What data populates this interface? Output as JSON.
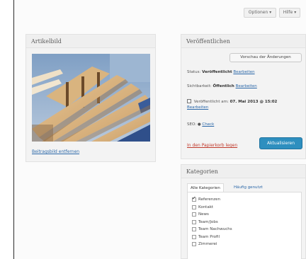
{
  "toolbar": {
    "options_label": "Optionen ▾",
    "help_label": "Hilfe ▾"
  },
  "featured": {
    "title": "Artikelbild",
    "remove_link": "Beitragsbild entfernen"
  },
  "publish": {
    "title": "Veröffentlichen",
    "preview_label": "Vorschau der Änderungen",
    "status_label": "Status:",
    "status_value": "Veröffentlicht",
    "status_edit": "Bearbeiten",
    "visibility_label": "Sichtbarkeit:",
    "visibility_value": "Öffentlich",
    "visibility_edit": "Bearbeiten",
    "published_label": "Veröffentlicht am:",
    "published_value": "07. Mai 2013 @ 15:02",
    "published_edit": "Bearbeiten",
    "seo_label": "SEO:",
    "seo_value": "Check",
    "trash_link": "In den Papierkorb legen",
    "update_label": "Aktualisieren"
  },
  "categories": {
    "title": "Kategorien",
    "tab_all": "Alle Kategorien",
    "tab_popular": "Häufig genutzt",
    "items": [
      {
        "label": "Referenzen",
        "checked": true
      },
      {
        "label": "Kontakt",
        "checked": false
      },
      {
        "label": "News",
        "checked": false
      },
      {
        "label": "Team/Jobs",
        "checked": false
      },
      {
        "label": "Team Nachwuchs",
        "checked": false
      },
      {
        "label": "Team Profil",
        "checked": false
      },
      {
        "label": "Zimmerei",
        "checked": false
      }
    ]
  }
}
